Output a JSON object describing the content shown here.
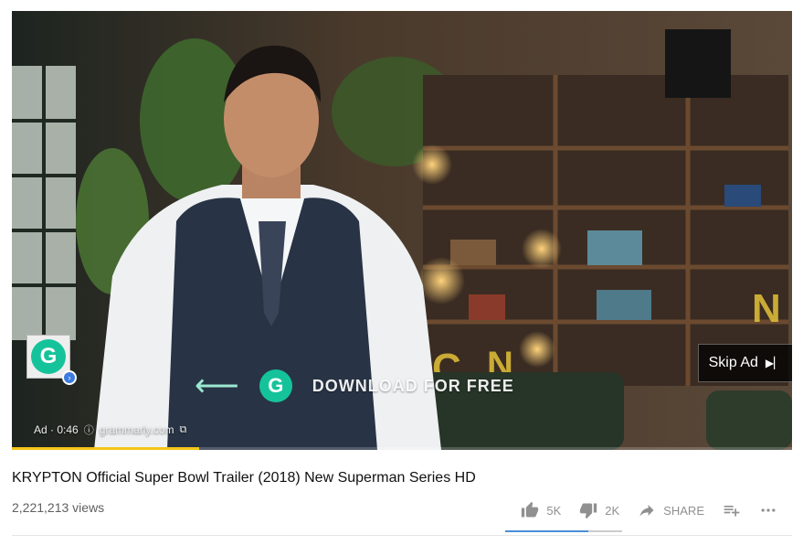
{
  "player": {
    "promo_text": "DOWNLOAD FOR FREE",
    "ad_label": "Ad · 0:46",
    "ad_domain": "grammarly.com",
    "skip_label": "Skip Ad",
    "ad_progress": 0.24,
    "advertiser_logo_letter": "G"
  },
  "video": {
    "title": "KRYPTON Official Super Bowl Trailer (2018) New Superman Series HD",
    "views": "2,221,213 views"
  },
  "actions": {
    "like_count": "5K",
    "dislike_count": "2K",
    "share_label": "SHARE",
    "like_ratio": 0.71
  },
  "colors": {
    "ad_progress": "#f5c518",
    "like_bar": "#4a8fd6",
    "grammarly": "#15c39a"
  }
}
